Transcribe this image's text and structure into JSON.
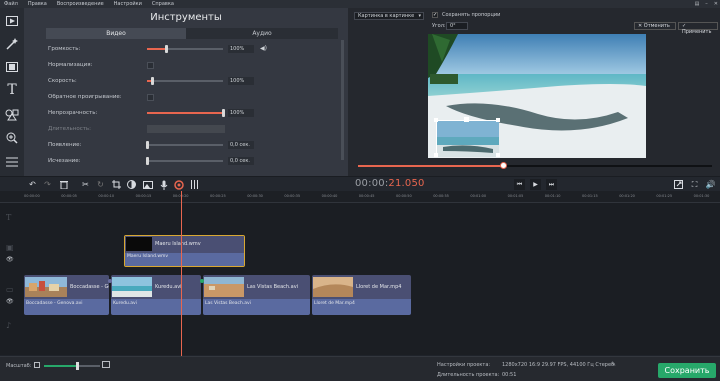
{
  "menu": [
    "Файл",
    "Правка",
    "Воспроизведение",
    "Настройки",
    "Справка"
  ],
  "panel": {
    "title": "Инструменты",
    "tabs": [
      "Видео",
      "Аудио"
    ],
    "rows": [
      {
        "label": "Громкость:",
        "type": "slider",
        "value": "100%",
        "fill": 0.25
      },
      {
        "label": "Нормализация:",
        "type": "checkbox"
      },
      {
        "label": "Скорость:",
        "type": "slider",
        "value": "100%",
        "fill": 0.06
      },
      {
        "label": "Обратное проигрывание:",
        "type": "checkbox"
      },
      {
        "label": "Непрозрачность:",
        "type": "slider",
        "value": "100%",
        "fill": 1.0
      },
      {
        "label": "Длительность:",
        "type": "disabled"
      },
      {
        "label": "Появление:",
        "type": "slider",
        "value": "0,0 сек.",
        "fill": 0.0
      },
      {
        "label": "Исчезание:",
        "type": "slider",
        "value": "0,0 сек.",
        "fill": 0.0
      }
    ]
  },
  "preview": {
    "mode_select": "Картинка в картинке",
    "keep_proportions": "Сохранять пропорции",
    "angle_label": "Угол:",
    "angle_value": "0°",
    "cancel": "Отменить",
    "apply": "Применить",
    "progress": 0.41
  },
  "timeline": {
    "timecode_a": "00:00:",
    "timecode_b": "21.050",
    "ticks": [
      "00:00:00",
      "00:00:05",
      "00:00:10",
      "00:00:15",
      "00:00:20",
      "00:00:25",
      "00:00:30",
      "00:00:35",
      "00:00:40",
      "00:00:45",
      "00:00:50",
      "00:00:55",
      "00:01:00",
      "00:01:05",
      "00:01:10",
      "00:01:15",
      "00:01:20",
      "00:01:25",
      "00:01:30"
    ],
    "overlay_clip": {
      "video": "Maeru Island.wmv",
      "audio": "Maeru Island.wmv"
    },
    "main_clips": [
      {
        "video": "Boccadasse - Ge",
        "audio": "Boccadasse - Genova.avi",
        "thumb": "harbor"
      },
      {
        "video": "Kuredu.avi",
        "audio": "Kuredu.avi",
        "thumb": "sea"
      },
      {
        "video": "Las Vistas Beach.avi",
        "audio": "Las Vistas Beach.avi",
        "thumb": "sand"
      },
      {
        "video": "Lloret de Mar.mp4",
        "audio": "Lloret de Mar.mp4",
        "thumb": "rocks"
      }
    ]
  },
  "status": {
    "scale_label": "Масштаб:",
    "settings_label": "Настройки проекта:",
    "settings_value": "1280x720 16:9 29.97 FPS, 44100 Гц Стерео",
    "duration_label": "Длительность проекта:",
    "duration_value": "00:51",
    "save": "Сохранить"
  },
  "colors": {
    "accent": "#e8664f",
    "save": "#27a86a",
    "clip": "#4a4f73",
    "audio": "#5a6aa0"
  }
}
